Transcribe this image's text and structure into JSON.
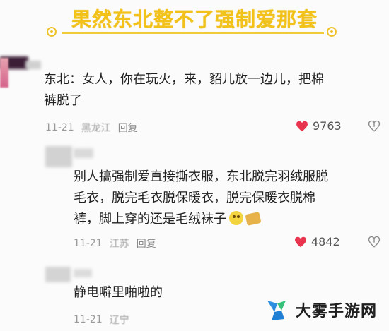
{
  "header": {
    "title": "果然东北整不了强制爱那套"
  },
  "comments": [
    {
      "text_line1": "东北：女人，你在玩火，来，貂儿放一边儿，把棉",
      "text_line2": "裤脱了",
      "date": "11-21",
      "location": "黑龙江",
      "reply": "回复",
      "likes": "9763"
    },
    {
      "text_line1": "别人搞强制爱直接撕衣服，东北脱完羽绒服脱",
      "text_line2": "毛衣，脱完毛衣脱保暖衣，脱完保暖衣脱棉",
      "text_line3": "裤，脚上穿的还是毛绒袜子",
      "date": "11-21",
      "location": "江苏",
      "reply": "回复",
      "likes": "4842"
    },
    {
      "text_line1": "静电噼里啪啦的",
      "date": "11-21",
      "location": "辽宁"
    }
  ],
  "watermark": {
    "text": "大雾手游网"
  },
  "colors": {
    "accent": "#f2c21a",
    "heart": "#e8344e",
    "watermark_blue": "#2d8fe0",
    "watermark_green": "#35c37a"
  },
  "icons": [
    "heart-icon",
    "dislike-icon",
    "smile-emoji-icon",
    "gift-emoji-icon",
    "watermark-logo-icon"
  ]
}
